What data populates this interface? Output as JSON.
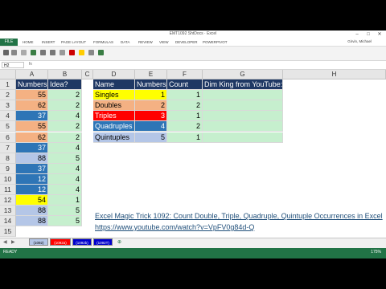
{
  "window": {
    "title": "EMT1092 ShtDocs · Excel"
  },
  "ribbon": {
    "file_tab": "FILE",
    "tabs": [
      "HOME",
      "INSERT",
      "PAGE LAYOUT",
      "FORMULAS",
      "DATA",
      "REVIEW",
      "VIEW",
      "DEVELOPER",
      "POWERPIVOT"
    ],
    "user": "Girvin, Michael"
  },
  "formula_bar": {
    "name_box": "H2",
    "fx": "fx"
  },
  "columns": [
    "A",
    "B",
    "C",
    "D",
    "E",
    "F",
    "G",
    "H"
  ],
  "rows": [
    "1",
    "2",
    "3",
    "4",
    "5",
    "6",
    "7",
    "8",
    "9",
    "10",
    "11",
    "12",
    "13",
    "14",
    "15"
  ],
  "col_a": {
    "header": "Numbers",
    "values": [
      "55",
      "62",
      "37",
      "55",
      "62",
      "37",
      "88",
      "37",
      "12",
      "12",
      "54",
      "88",
      "88"
    ],
    "colors": [
      "#f4b183",
      "#f4b183",
      "#2e75b6",
      "#f4b183",
      "#f4b183",
      "#2e75b6",
      "#b4c6e7",
      "#2e75b6",
      "#2e75b6",
      "#2e75b6",
      "#ffff00",
      "#b4c6e7",
      "#b4c6e7"
    ]
  },
  "col_b": {
    "header": "Idea?",
    "values": [
      "2",
      "2",
      "4",
      "2",
      "2",
      "4",
      "5",
      "4",
      "4",
      "4",
      "1",
      "5",
      "5"
    ]
  },
  "lookup": {
    "headers": {
      "name": "Name",
      "numbers": "Numbers",
      "count": "Count",
      "dim": "Dim King from YouTube:"
    },
    "rows": [
      {
        "name": "Singles",
        "numbers": "1",
        "count": "1",
        "color": "#ffff00"
      },
      {
        "name": "Doubles",
        "numbers": "2",
        "count": "2",
        "color": "#f4b183"
      },
      {
        "name": "Triples",
        "numbers": "3",
        "count": "1",
        "color": "#ff0000"
      },
      {
        "name": "Quadruples",
        "numbers": "4",
        "count": "2",
        "color": "#2e75b6"
      },
      {
        "name": "Quintuples",
        "numbers": "5",
        "count": "1",
        "color": "#b4c6e7"
      }
    ]
  },
  "links": {
    "line1": "Excel Magic Trick 1092: Count Double, Triple, Quadruple, Quintuple Occurrences in Excel",
    "line2": "https://www.youtube.com/watch?v=VpFV0g84d-Q"
  },
  "sheet_tabs": [
    {
      "label": "(1092)",
      "color": "#b4c6e7"
    },
    {
      "label": "(1092a)",
      "color": "#ff0000"
    },
    {
      "label": "(1092b)",
      "color": "#0000cc"
    },
    {
      "label": "(1092T)",
      "color": "#0000cc"
    }
  ],
  "status": {
    "ready": "READY",
    "zoom": "175%"
  },
  "colors": {
    "header_fill": "#1f3864",
    "table_fill": "#c6efce",
    "excel_green": "#217346"
  }
}
